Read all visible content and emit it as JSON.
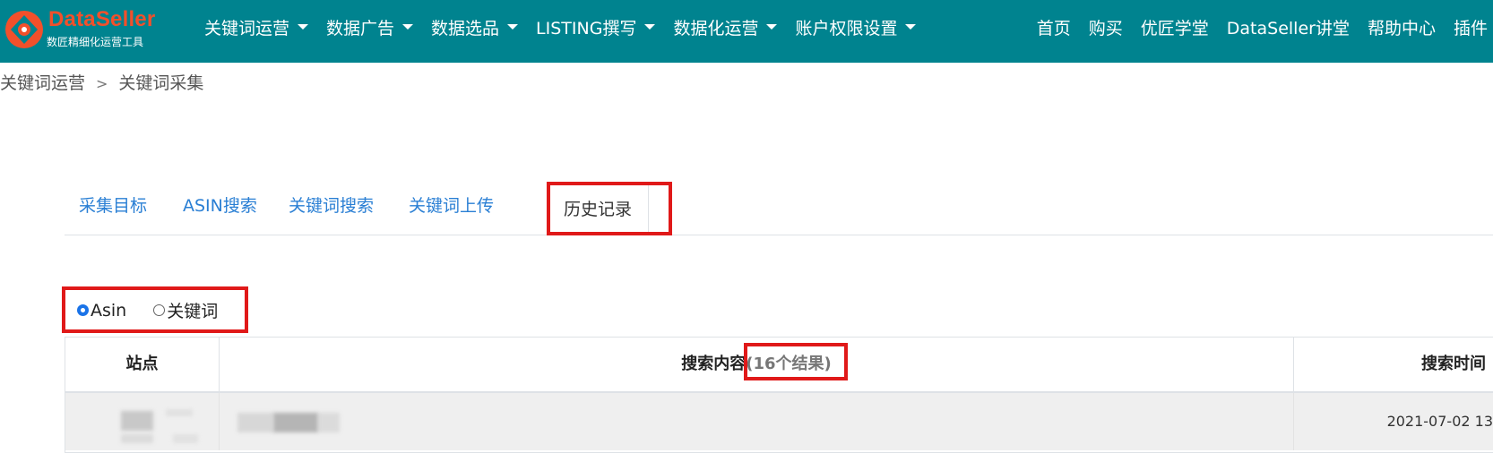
{
  "brand": {
    "name": "DataSeller",
    "tagline": "数匠精细化运营工具",
    "colors": {
      "nav": "#00838f",
      "logo": "#f2502b",
      "highlight": "#e01919",
      "link": "#2a7fd4"
    }
  },
  "nav": {
    "menu": [
      {
        "label": "关键词运营",
        "icon": "chevron-down-icon"
      },
      {
        "label": "数据广告",
        "icon": "chevron-down-icon"
      },
      {
        "label": "数据选品",
        "icon": "chevron-down-icon"
      },
      {
        "label": "LISTING撰写",
        "icon": "chevron-down-icon"
      },
      {
        "label": "数据化运营",
        "icon": "chevron-down-icon"
      },
      {
        "label": "账户权限设置",
        "icon": "chevron-down-icon"
      }
    ],
    "links": [
      "首页",
      "购买",
      "优匠学堂",
      "DataSeller讲堂",
      "帮助中心",
      "插件"
    ]
  },
  "breadcrumb": {
    "parent": "关键词运营",
    "separator": ">",
    "current": "关键词采集"
  },
  "tabs": [
    "采集目标",
    "ASIN搜索",
    "关键词搜索",
    "关键词上传",
    "历史记录"
  ],
  "active_tab": "历史记录",
  "search_type": {
    "options": [
      "Asin",
      "关键词"
    ],
    "selected": "Asin"
  },
  "table": {
    "headers": {
      "site": "站点",
      "content": "搜索内容",
      "result_count": "(16个结果)",
      "time": "搜索时间"
    },
    "rows": [
      {
        "time": "2021-07-02 13"
      }
    ]
  }
}
